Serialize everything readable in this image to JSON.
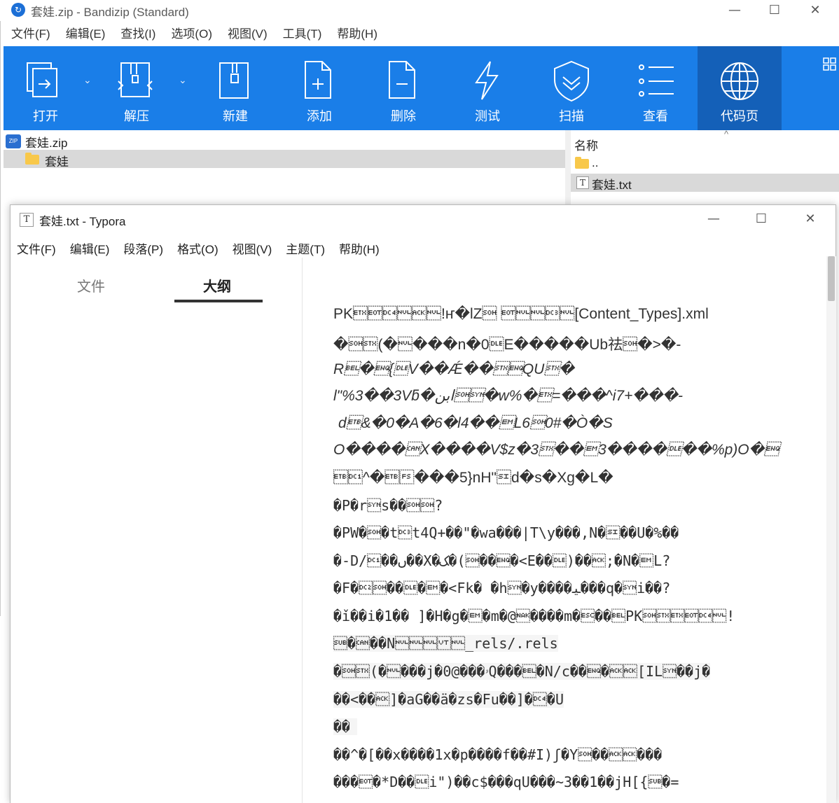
{
  "bandizip": {
    "title": "套娃.zip - Bandizip (Standard)",
    "logo": "↻",
    "window_controls": {
      "minimize": "—",
      "maximize": "☐",
      "close": "✕"
    },
    "menu": [
      "文件(F)",
      "编辑(E)",
      "查找(I)",
      "选项(O)",
      "视图(V)",
      "工具(T)",
      "帮助(H)"
    ],
    "toolbar": {
      "open": "打开",
      "extract": "解压",
      "new": "新建",
      "add": "添加",
      "delete": "删除",
      "test": "测试",
      "scan": "扫描",
      "view": "查看",
      "codepage": "代码页",
      "dropdown_arrow": "⌄",
      "layout_icon": "grid-icon"
    },
    "tree": {
      "root": "套娃.zip",
      "root_icon_text": "ZIP",
      "folder": "套娃"
    },
    "list": {
      "column_name": "名称",
      "sort_indicator": "^",
      "parent": "..",
      "file": "套娃.txt"
    }
  },
  "typora": {
    "title": "套娃.txt - Typora",
    "icon_letter": "T",
    "window_controls": {
      "minimize": "—",
      "maximize": "☐",
      "close": "✕"
    },
    "menu": [
      "文件(F)",
      "编辑(E)",
      "段落(P)",
      "格式(O)",
      "视图(V)",
      "主题(T)",
      "帮助(H)"
    ],
    "sidebar": {
      "tab_files": "文件",
      "tab_outline": "大纲"
    },
    "content_lines": [
      "PK\u0003\u0004\u0014\u0000\u0006\u0000!ҥ�lZ\u0001 \u0004\u0000\u0000\u0013\u0000[Content_Types].xml",
      "�\u0001\u0002(�\u0000���n�0\u0010E�����Ub祛\u0001�>�-",
      "R\u0007�\u0005{\u0010V��Ǽ��\u0002\u0005QU\u0002�",
      "l\"%3��3Vƃ�ابن\u0001\u0016�w%�\u0003=���^i7+���-",
      "d\u0017&�0�A�6�l4��\u0019L6\u00010#�Ò�S",
      "O����\u0018X����V$z�3\u0002��\u00193����\u0010��%p)O�\u0005",
      "\u0017\u0011^�\u0017\u001c���5}nH\"\u000fd�s�Xg�L�",
      "�P�r\u0016s��\u0001\u0001?",
      "�PW�\u0001�t\u0013t4Q+��\"�wa���|T\\y���,N�\u000f��U�%��",
      "�-D/\u0011��ﮞ��X�ﮏ�(\u0001��\u0005�<E��\u0010)��\u0006;�N�\u0019L?",
      "�F�\u0012\u0001��\u0010�\u0019�<Fk� �h\u0016�y����ﯿ���q�\u0016i��?",
      "�ǐ��i�1�� ]�H�g�\u0019�m�@\u0015����m�\u001b��\u0007PK\u0001\u0002\u0003\u0004\u0014\u0000!",
      "\u001a�\u0018��N\u0000\u0000\u0000\u000b\u0000_rels/.rels",
      "�\u0001\u0002(�\u0000���j�0@���ۥQ���\u0007�N/c��\u0005�\u0006\u0006[IL\u0016��j�",
      "��<��\u0006]�aG��ä�zs�Fu��]�\u0014�U",
      "��",
      "��^�[��x����1x�p����f��#I)ʃ�Y\u0001��\u0006\u0006���",
      "���\u0004�*D��\u0010i\")��c$���qU���~3��1��jH[{\u001a�="
    ]
  }
}
